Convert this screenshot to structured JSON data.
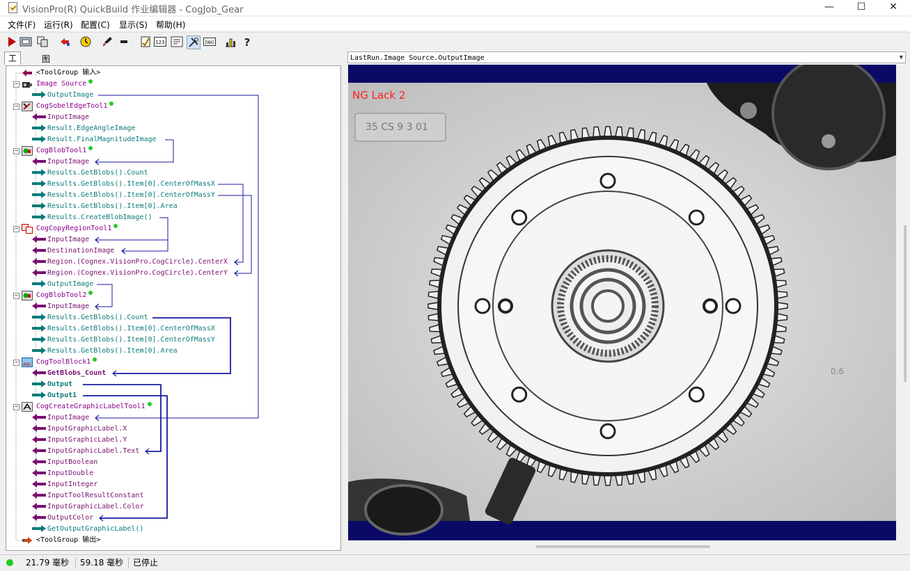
{
  "window": {
    "title": "VisionPro(R) QuickBuild 作业编辑器 - CogJob_Gear",
    "minimize": "—",
    "maximize": "☐",
    "close": "✕"
  },
  "menu": [
    "文件(F)",
    "运行(R)",
    "配置(C)",
    "显示(S)",
    "帮助(H)"
  ],
  "toolbar": {
    "icons": [
      "run-icon",
      "image-icon",
      "copy-icon",
      "reset-icon",
      "clock-icon",
      "brush-icon",
      "inputs-icon",
      "script-icon",
      "numeric-icon",
      "text-icon",
      "tools-icon",
      "debug-icon",
      "bar-chart-icon",
      "help-icon"
    ],
    "labels": {
      "num": "123",
      "dbg": "DBG"
    }
  },
  "tabs": [
    "工具",
    "图形"
  ],
  "tree": {
    "rows": [
      {
        "level": 0,
        "kind": "group",
        "label": "<ToolGroup 输入>",
        "icon": "input-arrow-icon"
      },
      {
        "level": 0,
        "kind": "tool",
        "label": "Image Source",
        "icon": "camera-icon",
        "dot": true
      },
      {
        "level": 1,
        "kind": "out",
        "label": "OutputImage"
      },
      {
        "level": 0,
        "kind": "tool",
        "label": "CogSobelEdgeTool1",
        "icon": "sobel-tool-icon",
        "dot": true
      },
      {
        "level": 1,
        "kind": "in",
        "label": "InputImage"
      },
      {
        "level": 1,
        "kind": "out",
        "label": "Result.EdgeAngleImage"
      },
      {
        "level": 1,
        "kind": "out",
        "label": "Result.FinalMagnitudeImage"
      },
      {
        "level": 0,
        "kind": "tool",
        "label": "CogBlobTool1",
        "icon": "blob-tool-icon",
        "dot": true
      },
      {
        "level": 1,
        "kind": "in",
        "label": "InputImage"
      },
      {
        "level": 1,
        "kind": "out",
        "label": "Results.GetBlobs().Count"
      },
      {
        "level": 1,
        "kind": "out",
        "label": "Results.GetBlobs().Item[0].CenterOfMassX"
      },
      {
        "level": 1,
        "kind": "out",
        "label": "Results.GetBlobs().Item[0].CenterOfMassY"
      },
      {
        "level": 1,
        "kind": "out",
        "label": "Results.GetBlobs().Item[0].Area"
      },
      {
        "level": 1,
        "kind": "out",
        "label": "Results.CreateBlobImage()"
      },
      {
        "level": 0,
        "kind": "tool",
        "label": "CogCopyRegionTool1",
        "icon": "copy-region-icon",
        "dot": true
      },
      {
        "level": 1,
        "kind": "in",
        "label": "InputImage"
      },
      {
        "level": 1,
        "kind": "in",
        "label": "DestinationImage"
      },
      {
        "level": 1,
        "kind": "in",
        "label": "Region.(Cognex.VisionPro.CogCircle).CenterX"
      },
      {
        "level": 1,
        "kind": "in",
        "label": "Region.(Cognex.VisionPro.CogCircle).CenterY"
      },
      {
        "level": 1,
        "kind": "out",
        "label": "OutputImage"
      },
      {
        "level": 0,
        "kind": "tool",
        "label": "CogBlobTool2",
        "icon": "blob-tool-icon",
        "dot": true
      },
      {
        "level": 1,
        "kind": "in",
        "label": "InputImage"
      },
      {
        "level": 1,
        "kind": "out",
        "label": "Results.GetBlobs().Count"
      },
      {
        "level": 1,
        "kind": "out",
        "label": "Results.GetBlobs().Item[0].CenterOfMassX"
      },
      {
        "level": 1,
        "kind": "out",
        "label": "Results.GetBlobs().Item[0].CenterOfMassY"
      },
      {
        "level": 1,
        "kind": "out",
        "label": "Results.GetBlobs().Item[0].Area"
      },
      {
        "level": 0,
        "kind": "tool",
        "label": "CogToolBlock1",
        "icon": "toolblock-icon",
        "dot": true
      },
      {
        "level": 1,
        "kind": "in",
        "label": "GetBlobs_Count",
        "bold": true
      },
      {
        "level": 1,
        "kind": "out",
        "label": "Output",
        "bold": true
      },
      {
        "level": 1,
        "kind": "out",
        "label": "Output1",
        "bold": true
      },
      {
        "level": 0,
        "kind": "tool",
        "label": "CogCreateGraphicLabelTool1",
        "icon": "label-tool-icon",
        "dot": true
      },
      {
        "level": 1,
        "kind": "in",
        "label": "InputImage"
      },
      {
        "level": 1,
        "kind": "in",
        "label": "InputGraphicLabel.X"
      },
      {
        "level": 1,
        "kind": "in",
        "label": "InputGraphicLabel.Y"
      },
      {
        "level": 1,
        "kind": "in",
        "label": "InputGraphicLabel.Text"
      },
      {
        "level": 1,
        "kind": "in",
        "label": "InputBoolean"
      },
      {
        "level": 1,
        "kind": "in",
        "label": "InputDouble"
      },
      {
        "level": 1,
        "kind": "in",
        "label": "InputInteger"
      },
      {
        "level": 1,
        "kind": "in",
        "label": "InputToolResultConstant"
      },
      {
        "level": 1,
        "kind": "in",
        "label": "InputGraphicLabel.Color"
      },
      {
        "level": 1,
        "kind": "in",
        "label": "OutputColor"
      },
      {
        "level": 1,
        "kind": "out",
        "label": "GetOutputGraphicLabel()"
      },
      {
        "level": 0,
        "kind": "group",
        "label": "<ToolGroup 输出>",
        "icon": "output-arrow-icon"
      }
    ]
  },
  "image_panel": {
    "selector": "LastRun.Image Source.OutputImage",
    "overlay_text": "NG  Lack 2",
    "overlay_color": "#ff2020",
    "plate_text": "35 CS 9 3 01",
    "side_text": "0.6"
  },
  "status": {
    "t1": "21.79 毫秒",
    "t2": "59.18 毫秒",
    "state": "已停止",
    "led_color": "#22cc22"
  }
}
